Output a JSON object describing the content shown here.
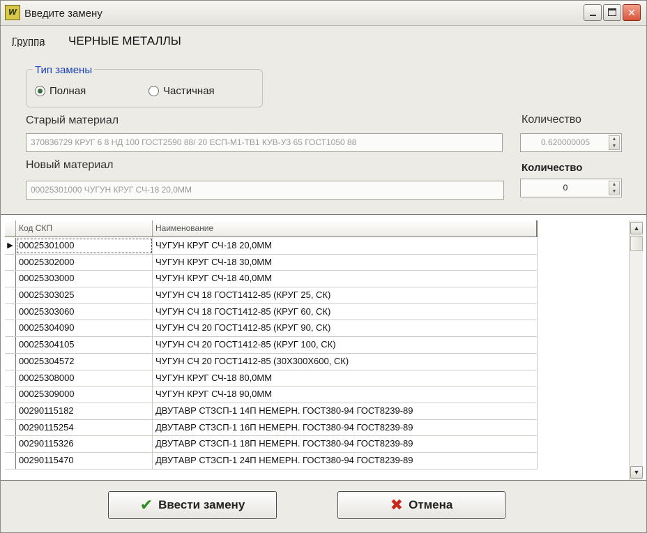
{
  "window": {
    "title": "Введите замену",
    "icon_text": "W"
  },
  "group": {
    "label": "Группа",
    "value": "ЧЕРНЫЕ МЕТАЛЛЫ"
  },
  "replace_type": {
    "legend": "Тип замены",
    "options": [
      {
        "label": "Полная",
        "selected": true
      },
      {
        "label": "Частичная",
        "selected": false
      }
    ]
  },
  "old_material": {
    "label": "Старый материал",
    "value": "370836729 КРУГ 6 8 НД 100 ГОСТ2590 88/ 20 ЕСП-М1-ТВ1 КУВ-УЗ 65 ГОСТ1050 88",
    "qty_label": "Количество",
    "qty_value": "0.620000005"
  },
  "new_material": {
    "label": "Новый материал",
    "value": "00025301000 ЧУГУН КРУГ СЧ-18 20,0ММ",
    "qty_label": "Количество",
    "qty_value": "0"
  },
  "table": {
    "columns": [
      "Код СКП",
      "Наименование"
    ],
    "rows": [
      {
        "code": "00025301000",
        "name": "ЧУГУН КРУГ СЧ-18 20,0ММ",
        "current": true
      },
      {
        "code": "00025302000",
        "name": "ЧУГУН КРУГ СЧ-18 30,0ММ"
      },
      {
        "code": "00025303000",
        "name": "ЧУГУН КРУГ СЧ-18 40,0ММ"
      },
      {
        "code": "00025303025",
        "name": "ЧУГУН СЧ 18 ГОСТ1412-85 (КРУГ 25, СК)"
      },
      {
        "code": "00025303060",
        "name": "ЧУГУН СЧ 18 ГОСТ1412-85 (КРУГ 60, СК)"
      },
      {
        "code": "00025304090",
        "name": "ЧУГУН СЧ 20 ГОСТ1412-85 (КРУГ 90, СК)"
      },
      {
        "code": "00025304105",
        "name": "ЧУГУН СЧ 20 ГОСТ1412-85 (КРУГ 100, СК)"
      },
      {
        "code": "00025304572",
        "name": "ЧУГУН СЧ 20 ГОСТ1412-85 (30X300X600, СК)"
      },
      {
        "code": "00025308000",
        "name": "ЧУГУН КРУГ СЧ-18 80,0ММ"
      },
      {
        "code": "00025309000",
        "name": "ЧУГУН КРУГ СЧ-18 90,0ММ"
      },
      {
        "code": "00290115182",
        "name": "ДВУТАВР СТЗСП-1 14П НЕМЕРН. ГОСТ380-94 ГОСТ8239-89"
      },
      {
        "code": "00290115254",
        "name": "ДВУТАВР СТЗСП-1 16П НЕМЕРН. ГОСТ380-94 ГОСТ8239-89"
      },
      {
        "code": "00290115326",
        "name": "ДВУТАВР СТЗСП-1 18П НЕМЕРН. ГОСТ380-94 ГОСТ8239-89"
      },
      {
        "code": "00290115470",
        "name": "ДВУТАВР СТЗСП-1 24П НЕМЕРН. ГОСТ380-94 ГОСТ8239-89"
      }
    ]
  },
  "buttons": {
    "ok": "Ввести замену",
    "cancel": "Отмена"
  },
  "icons": {
    "ok": "checkmark-icon",
    "cancel": "x-icon",
    "radio_on": "radio-selected-icon",
    "radio_off": "radio-unselected-icon"
  },
  "colors": {
    "legend": "#1b3fb8",
    "ok_icon": "#2a8a1f",
    "cancel_icon": "#c8281a",
    "close_button": "#d7553a"
  }
}
